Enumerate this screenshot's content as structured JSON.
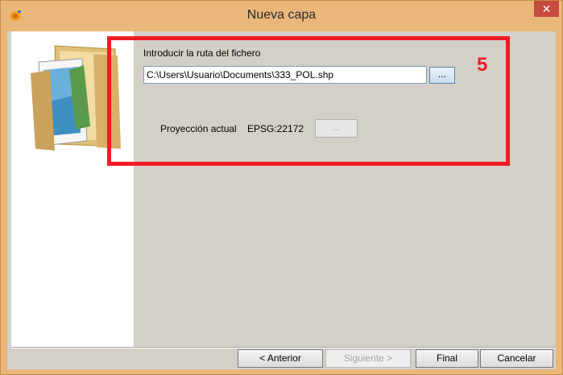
{
  "window": {
    "title": "Nueva capa",
    "close_label": "✕"
  },
  "form": {
    "path_label": "Introducir la ruta del fichero",
    "path_value": "C:\\Users\\Usuario\\Documents\\333_POL.shp",
    "browse_label": "...",
    "projection_label": "Proyección actual",
    "projection_value": "EPSG:22172",
    "projection_button_label": "..."
  },
  "annotation": {
    "step_number": "5",
    "color": "#ee1c24"
  },
  "footer": {
    "back_label": "< Anterior",
    "next_label": "Siguiente >",
    "finish_label": "Final",
    "cancel_label": "Cancelar"
  },
  "icons": {
    "app": "app-icon",
    "wizard": "folder-document-icon",
    "close": "close-icon"
  }
}
